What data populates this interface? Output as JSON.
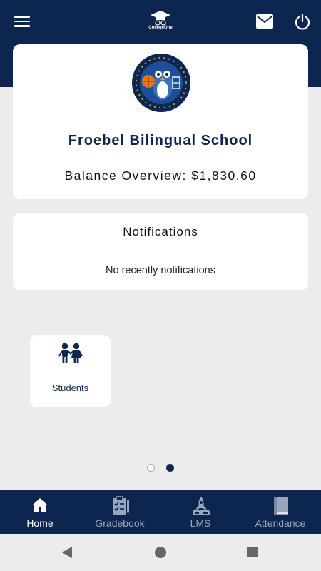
{
  "header": {
    "app_name": "CollegeOne",
    "menu_icon": "menu-icon",
    "mail_icon": "mail-icon",
    "power_icon": "power-icon",
    "brand_color": "#0c2650"
  },
  "school": {
    "name": "Froebel Bilingual School",
    "balance_text": "Balance Overview: $1,830.60",
    "crest_icon": "school-crest-owl-icon"
  },
  "notifications": {
    "title": "Notifications",
    "empty_message": "No recently notifications"
  },
  "tiles": [
    {
      "label": "Students",
      "icon": "students-icon"
    }
  ],
  "pager": {
    "page_count": 2,
    "active_page": 2
  },
  "bottom_nav": {
    "items": [
      {
        "label": "Home",
        "icon": "home-icon",
        "active": true
      },
      {
        "label": "Gradebook",
        "icon": "clipboard-icon",
        "active": false
      },
      {
        "label": "LMS",
        "icon": "rocket-icon",
        "active": false
      },
      {
        "label": "Attendance",
        "icon": "book-icon",
        "active": false
      }
    ]
  },
  "system_nav": {
    "back": "back-icon",
    "home": "home-circle-icon",
    "recent": "recent-apps-icon"
  }
}
